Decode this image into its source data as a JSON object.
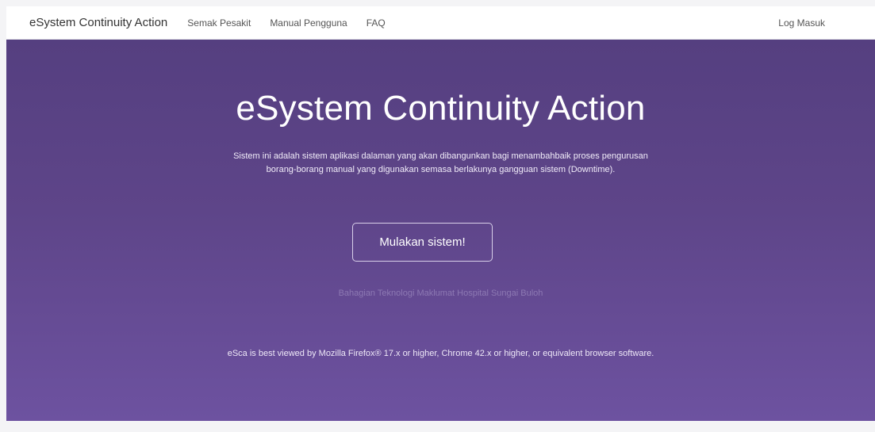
{
  "navbar": {
    "brand": "eSystem Continuity Action",
    "links": [
      "Semak Pesakit",
      "Manual Pengguna",
      "FAQ"
    ],
    "login": "Log Masuk"
  },
  "hero": {
    "title": "eSystem Continuity Action",
    "description": "Sistem ini adalah sistem aplikasi dalaman yang akan dibangunkan bagi menambahbaik proses pengurusan borang-borang manual yang digunakan semasa berlakunya gangguan sistem (Downtime).",
    "button_label": "Mulakan sistem!",
    "organization": "Bahagian Teknologi Maklumat Hospital Sungai Buloh",
    "browser_note": "eSca is best viewed by Mozilla Firefox® 17.x or higher, Chrome 42.x or higher, or equivalent browser software."
  },
  "colors": {
    "hero_top": "#553f80",
    "hero_bottom": "#6d52a0",
    "navbar_bg": "#ffffff"
  }
}
